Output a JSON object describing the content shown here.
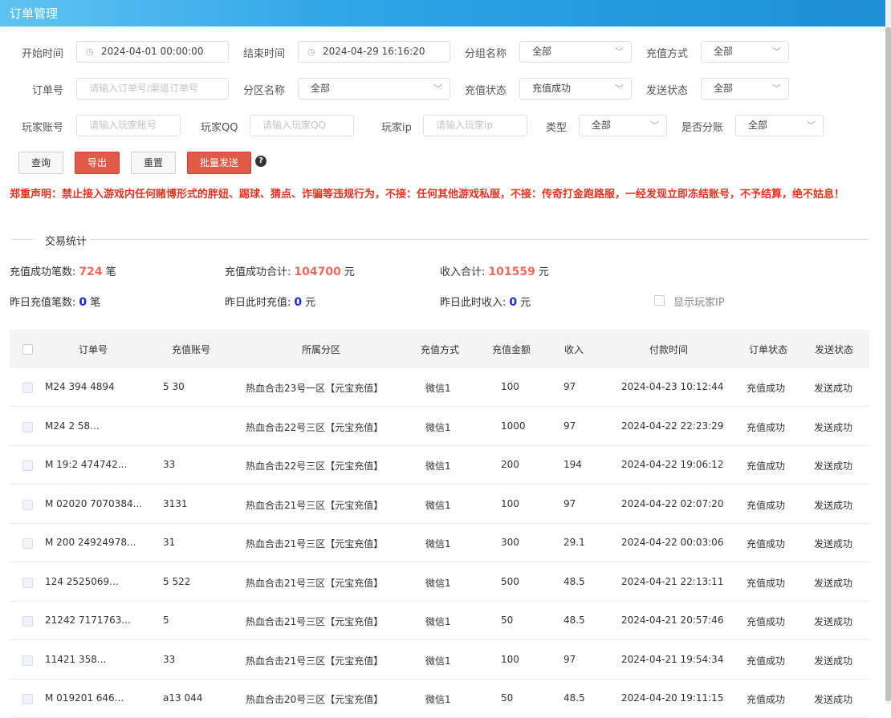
{
  "header": {
    "title": "订单管理"
  },
  "filters": {
    "start_time": {
      "label": "开始时间",
      "value": "2024-04-01 00:00:00"
    },
    "end_time": {
      "label": "结束时间",
      "value": "2024-04-29 16:16:20"
    },
    "group_name": {
      "label": "分组名称",
      "value": "全部"
    },
    "recharge_method": {
      "label": "充值方式",
      "value": "全部"
    },
    "order_no": {
      "label": "订单号",
      "placeholder": "请输入订单号/渠道订单号"
    },
    "zone_name": {
      "label": "分区名称",
      "value": "全部"
    },
    "recharge_status": {
      "label": "充值状态",
      "value": "充值成功"
    },
    "send_status": {
      "label": "发送状态",
      "value": "全部"
    },
    "player_account": {
      "label": "玩家账号",
      "placeholder": "请输入玩家账号"
    },
    "player_qq": {
      "label": "玩家QQ",
      "placeholder": "请输入玩家QQ"
    },
    "player_ip": {
      "label": "玩家ip",
      "placeholder": "请输入玩家ip"
    },
    "type": {
      "label": "类型",
      "value": "全部"
    },
    "split": {
      "label": "是否分账",
      "value": "全部"
    }
  },
  "toolbar": {
    "query": "查询",
    "export": "导出",
    "reset": "重置",
    "batch_send": "批量发送",
    "help_icon": "?"
  },
  "notice": "郑重声明：禁止接入游戏内任何赌博形式的胖妞、踢球、猜点、诈骗等违规行为，不接：任何其他游戏私服，不接：传奇打金跑路服，一经发现立即冻结账号，不予结算，绝不姑息！",
  "stats": {
    "section_title": "交易统计",
    "success_count_label": "充值成功笔数:",
    "success_count": "724",
    "success_count_unit": "笔",
    "success_total_label": "充值成功合计:",
    "success_total": "104700",
    "success_total_unit": "元",
    "income_total_label": "收入合计:",
    "income_total": "101559",
    "income_total_unit": "元",
    "yesterday_count_label": "昨日充值笔数:",
    "yesterday_count": "0",
    "yesterday_count_unit": "笔",
    "yesterday_recharge_label": "昨日此时充值:",
    "yesterday_recharge": "0",
    "yesterday_recharge_unit": "元",
    "yesterday_income_label": "昨日此时收入:",
    "yesterday_income": "0",
    "yesterday_income_unit": "元",
    "show_ip_label": "显示玩家IP"
  },
  "table": {
    "columns": [
      "订单号",
      "充值账号",
      "所属分区",
      "充值方式",
      "充值金额",
      "收入",
      "付款时间",
      "订单状态",
      "发送状态"
    ],
    "rows": [
      [
        "M24  394  4894",
        "5  30",
        "热血合击23号一区【元宝充值】",
        "微信1",
        "100",
        "97",
        "2024-04-23 10:12:44",
        "充值成功",
        "发送成功"
      ],
      [
        "M24  2  58...",
        "  ",
        "热血合击22号三区【元宝充值】",
        "微信1",
        "1000",
        "97",
        "2024-04-22 22:23:29",
        "充值成功",
        "发送成功"
      ],
      [
        "M  19:2  474742...",
        "  33",
        "热血合击22号三区【元宝充值】",
        "微信1",
        "200",
        "194",
        "2024-04-22 19:06:12",
        "充值成功",
        "发送成功"
      ],
      [
        "M  02020  7070384...",
        "3131",
        "热血合击21号三区【元宝充值】",
        "微信1",
        "100",
        "97",
        "2024-04-22 02:07:20",
        "充值成功",
        "发送成功"
      ],
      [
        "M  200  24924978...",
        "  31",
        "热血合击21号三区【元宝充值】",
        "微信1",
        "300",
        "29.1",
        "2024-04-22 00:03:06",
        "充值成功",
        "发送成功"
      ],
      [
        "  124  2525069...",
        "5  522",
        "热血合击21号三区【元宝充值】",
        "微信1",
        "500",
        "48.5",
        "2024-04-21 22:13:11",
        "充值成功",
        "发送成功"
      ],
      [
        "  21242  7171763...",
        "5  ",
        "热血合击21号三区【元宝充值】",
        "微信1",
        "50",
        "48.5",
        "2024-04-21 20:57:46",
        "充值成功",
        "发送成功"
      ],
      [
        "  11421  358...",
        "  33",
        "热血合击21号三区【元宝充值】",
        "微信1",
        "100",
        "97",
        "2024-04-21 19:54:34",
        "充值成功",
        "发送成功"
      ],
      [
        "M  019201  646...",
        "a13  044",
        "热血合击20号三区【元宝充值】",
        "微信1",
        "50",
        "48.5",
        "2024-04-20 19:11:15",
        "充值成功",
        "发送成功"
      ]
    ]
  }
}
